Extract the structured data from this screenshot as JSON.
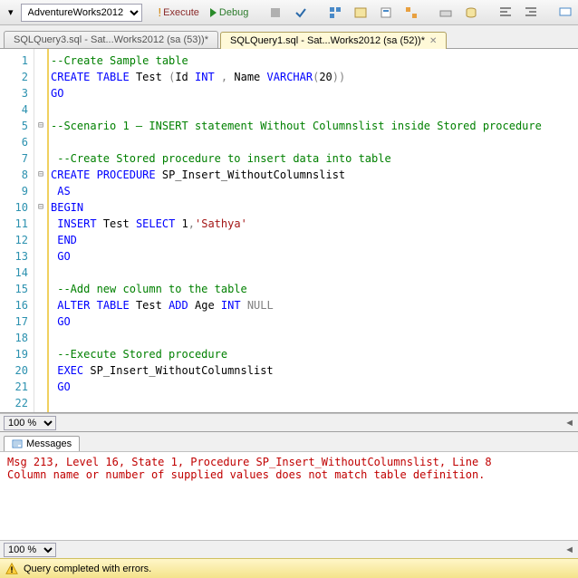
{
  "toolbar": {
    "database": "AdventureWorks2012",
    "execute": "Execute",
    "debug": "Debug"
  },
  "tabs": [
    {
      "label": "SQLQuery3.sql - Sat...Works2012 (sa (53))*",
      "active": false
    },
    {
      "label": "SQLQuery1.sql - Sat...Works2012 (sa (52))*",
      "active": true
    }
  ],
  "code": {
    "lines": [
      {
        "n": 1,
        "html": "<span class='cm'>--Create Sample table</span>"
      },
      {
        "n": 2,
        "html": "<span class='kw'>CREATE</span> <span class='kw'>TABLE</span> Test <span class='gray'>(</span>Id <span class='kw'>INT</span> <span class='gray'>,</span> Name <span class='kw'>VARCHAR</span><span class='gray'>(</span>20<span class='gray'>))</span>"
      },
      {
        "n": 3,
        "html": "<span class='kw'>GO</span>"
      },
      {
        "n": 4,
        "html": ""
      },
      {
        "n": 5,
        "html": "<span class='cm'>--Scenario 1 – INSERT statement Without Columnslist inside Stored procedure</span>",
        "fold": "⊟"
      },
      {
        "n": 6,
        "html": ""
      },
      {
        "n": 7,
        "html": " <span class='cm'>--Create Stored procedure to insert data into table</span>"
      },
      {
        "n": 8,
        "html": "<span class='kw'>CREATE</span> <span class='kw'>PROCEDURE</span> SP_Insert_WithoutColumnslist",
        "fold": "⊟"
      },
      {
        "n": 9,
        "html": " <span class='kw'>AS</span>"
      },
      {
        "n": 10,
        "html": "<span class='kw'>BEGIN</span>",
        "fold": "⊟"
      },
      {
        "n": 11,
        "html": " <span class='kw'>INSERT</span> Test <span class='kw'>SELECT</span> 1<span class='gray'>,</span><span class='str'>'Sathya'</span>"
      },
      {
        "n": 12,
        "html": " <span class='kw'>END</span>"
      },
      {
        "n": 13,
        "html": " <span class='kw'>GO</span>"
      },
      {
        "n": 14,
        "html": ""
      },
      {
        "n": 15,
        "html": " <span class='cm'>--Add new column to the table</span>"
      },
      {
        "n": 16,
        "html": " <span class='kw'>ALTER</span> <span class='kw'>TABLE</span> Test <span class='kw'>ADD</span> Age <span class='kw'>INT</span> <span class='gray'>NULL</span>"
      },
      {
        "n": 17,
        "html": " <span class='kw'>GO</span>"
      },
      {
        "n": 18,
        "html": ""
      },
      {
        "n": 19,
        "html": " <span class='cm'>--Execute Stored procedure</span>"
      },
      {
        "n": 20,
        "html": " <span class='kw'>EXEC</span> SP_Insert_WithoutColumnslist"
      },
      {
        "n": 21,
        "html": " <span class='kw'>GO</span>"
      },
      {
        "n": 22,
        "html": ""
      }
    ]
  },
  "zoom": {
    "value": "100 %"
  },
  "messages_tab": "Messages",
  "messages": "Msg 213, Level 16, State 1, Procedure SP_Insert_WithoutColumnslist, Line 8\nColumn name or number of supplied values does not match table definition.",
  "zoom2": {
    "value": "100 %"
  },
  "status": "Query completed with errors."
}
